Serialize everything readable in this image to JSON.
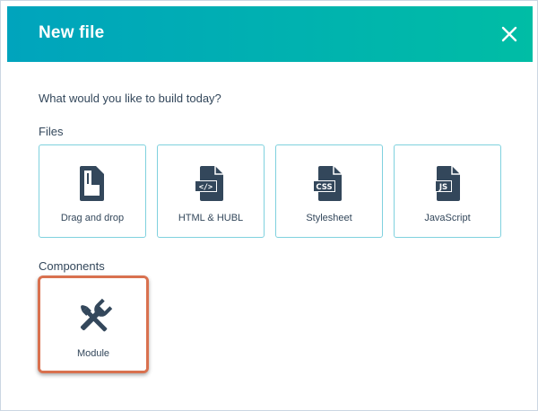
{
  "dialog": {
    "title": "New file",
    "prompt": "What would you like to build today?"
  },
  "files": {
    "heading": "Files",
    "items": [
      {
        "label": "Drag and drop",
        "icon": "drag-and-drop-file-icon"
      },
      {
        "label": "HTML & HUBL",
        "icon": "html-code-file-icon",
        "badge": "</>"
      },
      {
        "label": "Stylesheet",
        "icon": "css-file-icon",
        "badge": "CSS"
      },
      {
        "label": "JavaScript",
        "icon": "js-file-icon",
        "badge": "JS"
      }
    ]
  },
  "components": {
    "heading": "Components",
    "items": [
      {
        "label": "Module",
        "icon": "wrench-brush-icon",
        "highlighted": true
      }
    ]
  },
  "colors": {
    "header_start": "#00a4bd",
    "header_end": "#00bda5",
    "tile_border": "#7fd1de",
    "text": "#33475b",
    "icon": "#33475b",
    "highlight": "#d9714f"
  }
}
